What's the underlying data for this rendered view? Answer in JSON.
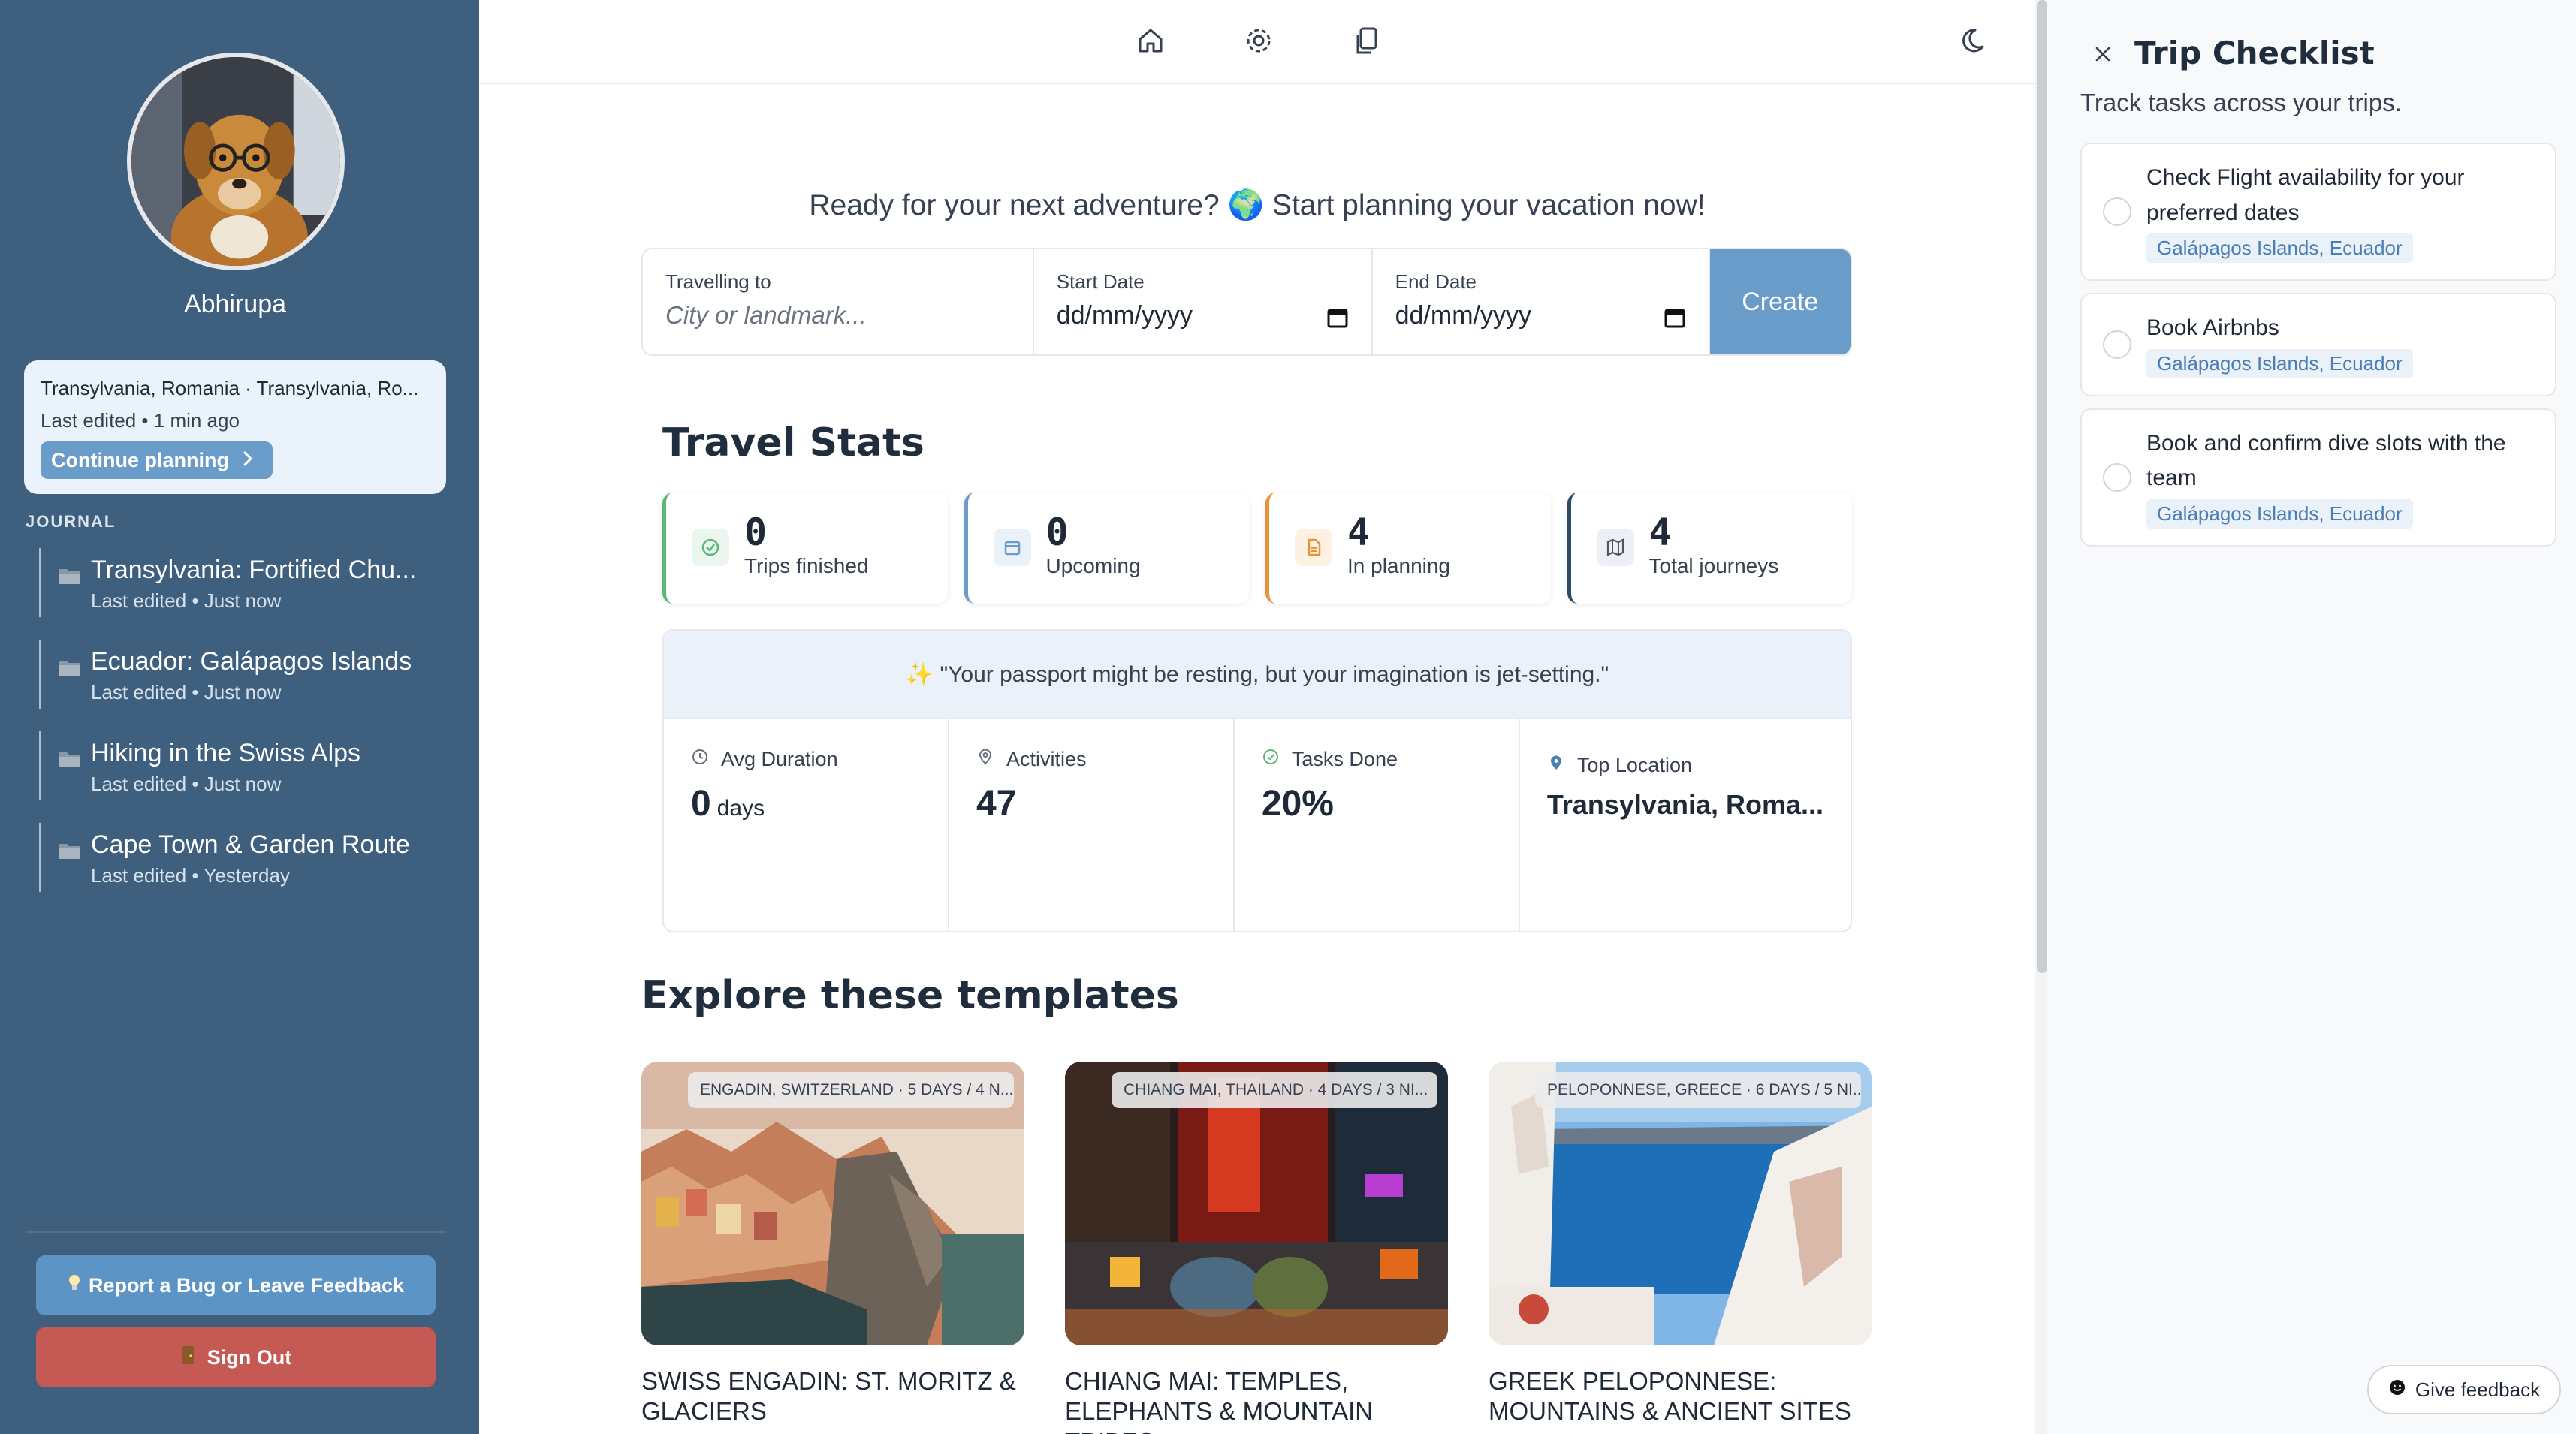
{
  "user": {
    "name": "Abhirupa"
  },
  "recent": {
    "title": "Transylvania, Romania · Transylvania, Ro...",
    "meta": "Last edited • 1 min ago",
    "continue_label": "Continue planning"
  },
  "journal": {
    "label": "JOURNAL",
    "items": [
      {
        "name": "Transylvania: Fortified Chu...",
        "edited": "Last edited • Just now"
      },
      {
        "name": "Ecuador: Galápagos Islands",
        "edited": "Last edited • Just now"
      },
      {
        "name": "Hiking in the Swiss Alps",
        "edited": "Last edited • Just now"
      },
      {
        "name": "Cape Town & Garden Route",
        "edited": "Last edited • Yesterday"
      }
    ]
  },
  "sidebar_actions": {
    "bug_label": "Report a Bug or Leave Feedback",
    "signout_label": "Sign Out"
  },
  "hero": {
    "text_before": "Ready for your next adventure?",
    "emoji": "🌍",
    "text_after": "Start planning your vacation now!"
  },
  "form": {
    "destination_label": "Travelling to",
    "destination_placeholder": "City or landmark...",
    "start_label": "Start Date",
    "start_value": "dd/mm/yyyy",
    "end_label": "End Date",
    "end_value": "dd/mm/yyyy",
    "create_label": "Create"
  },
  "stats": {
    "title": "Travel Stats",
    "cards": [
      {
        "value": "0",
        "caption": "Trips finished",
        "color": "#5cb87a",
        "icon": "check-circle-icon"
      },
      {
        "value": "0",
        "caption": "Upcoming",
        "color": "#6a9cc9",
        "icon": "calendar-icon"
      },
      {
        "value": "4",
        "caption": "In planning",
        "color": "#e8923a",
        "icon": "document-icon"
      },
      {
        "value": "4",
        "caption": "Total journeys",
        "color": "#2f4a66",
        "icon": "map-icon"
      }
    ],
    "quote": "✨ \"Your passport might be resting, but your imagination is jet-setting.\"",
    "metrics": [
      {
        "label": "Avg Duration",
        "value": "0",
        "unit": "days",
        "icon": "clock-icon"
      },
      {
        "label": "Activities",
        "value": "47",
        "unit": "",
        "icon": "pin-outline-icon"
      },
      {
        "label": "Tasks Done",
        "value": "20%",
        "unit": "",
        "icon": "check-circle-icon"
      },
      {
        "label": "Top Location",
        "value": "Transylvania, Roma...",
        "unit": "",
        "icon": "pin-filled-icon"
      }
    ]
  },
  "templates": {
    "title": "Explore these templates",
    "items": [
      {
        "badge": "Engadin, Switzerland · 5 days / 4 N...",
        "name": "Swiss Engadin: St. Moritz & Glaciers"
      },
      {
        "badge": "Chiang Mai, Thailand · 4 days / 3 Ni...",
        "name": "Chiang Mai: Temples, Elephants & Mountain Tribes"
      },
      {
        "badge": "Peloponnese, Greece · 6 days / 5 Ni...",
        "name": "Greek Peloponnese: Mountains & Ancient Sites"
      }
    ]
  },
  "checklist": {
    "title": "Trip Checklist",
    "subtitle": "Track tasks across your trips.",
    "tasks": [
      {
        "text": "Check Flight availability for your preferred dates",
        "trip": "Galápagos Islands, Ecuador"
      },
      {
        "text": "Book Airbnbs",
        "trip": "Galápagos Islands, Ecuador"
      },
      {
        "text": "Book and confirm dive slots with the team",
        "trip": "Galápagos Islands, Ecuador"
      }
    ]
  },
  "feedback": {
    "label": "Give feedback"
  },
  "colors": {
    "sidebar": "#3e5f7d",
    "accent": "#6a9cc9",
    "danger": "#c55a55",
    "panel": "#f7f9fb"
  }
}
